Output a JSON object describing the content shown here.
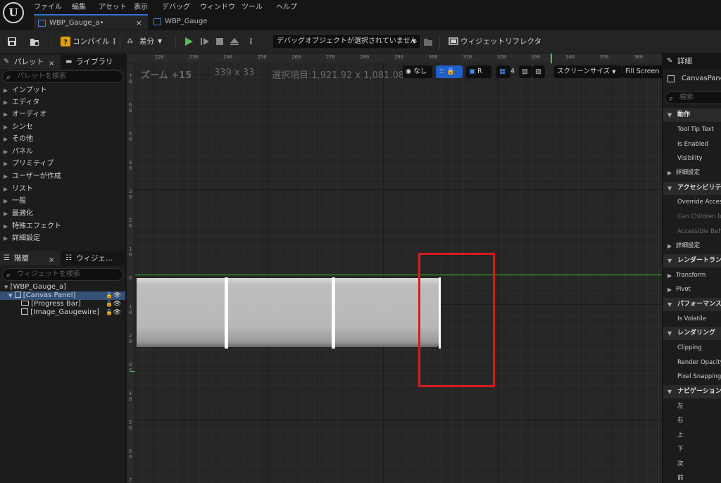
{
  "menu": {
    "logo": "U",
    "items": [
      "ファイル",
      "編集",
      "アセット",
      "表示",
      "デバッグ",
      "ウィンドウ",
      "ツール",
      "ヘルプ"
    ]
  },
  "tabs": [
    {
      "label": "WBP_Gauge_a•",
      "close": "×"
    },
    {
      "label": "WBP_Gauge"
    }
  ],
  "toolbar": {
    "compile_label": "コンパイル",
    "diff_label": "差分",
    "debug_object": "デバッグオブジェクトが選択されていません",
    "widget_reflector_label": "ウィジェットリフレクタ"
  },
  "palette": {
    "tab_palette": "パレット",
    "tab_library": "ライブラリ",
    "close": "×",
    "search_placeholder": "パレットを検索",
    "categories": [
      "インプット",
      "エディタ",
      "オーディオ",
      "シンセ",
      "その他",
      "パネル",
      "プリミティブ",
      "ユーザーが作成",
      "リスト",
      "一般",
      "最適化",
      "特殊エフェクト",
      "詳細設定"
    ]
  },
  "hierarchy": {
    "tab_hierarchy": "階層",
    "tab_widget": "ウィジェ...",
    "close": "×",
    "search_placeholder": "ウィジェットを検索",
    "root": "[WBP_Gauge_a]",
    "canvas_panel": "[Canvas Panel]",
    "progress_bar": "[Progress Bar]",
    "image_gaugewire": "[Image_Gaugewire]"
  },
  "canvas": {
    "zoom": "ズーム +15",
    "size": "339 x 33",
    "selection": "選択項目:1,921.92 x 1,081.08",
    "none_label": "なし",
    "r_label": "R",
    "grid_value": "4",
    "screen_size": "スクリーンサイズ",
    "fill_screen": "Fill Screen",
    "ruler_top": [
      "220",
      "230",
      "240",
      "250",
      "260",
      "270",
      "280",
      "290",
      "300",
      "310",
      "320",
      "330",
      "340",
      "350",
      "360",
      "370"
    ],
    "ruler_left": [
      "7\n0",
      "6\n0",
      "5\n0",
      "4\n0",
      "3\n0",
      "2\n0",
      "1\n0",
      "0",
      "1\n0",
      "2\n0",
      "3\n0",
      "4\n0",
      "5\n0",
      "6\n0",
      "7\n0"
    ]
  },
  "details": {
    "title": "詳細",
    "object_name": "CanvasPanel",
    "search_placeholder": "検索",
    "sections": {
      "behavior": "動作",
      "accessibility": "アクセシビリティ",
      "render_transform": "レンダートランスフォーム",
      "performance": "パフォーマンス",
      "rendering": "レンダリング",
      "navigation": "ナビゲーション"
    },
    "props": {
      "tooltip": "Tool Tip Text",
      "is_enabled": "Is Enabled",
      "visibility": "Visibility",
      "advanced1": "詳細設定",
      "override_access": "Override Accessible",
      "can_children": "Can Children be Accessible",
      "accessible_behavior": "Accessible Behavior",
      "advanced2": "詳細設定",
      "transform": "Transform",
      "pivot": "Pivot",
      "is_volatile": "Is Volatile",
      "clipping": "Clipping",
      "render_opacity": "Render Opacity",
      "pixel_snapping": "Pixel Snapping",
      "nav_left": "左",
      "nav_right": "右",
      "nav_up": "上",
      "nav_down": "下",
      "nav_next": "次",
      "nav_prev": "前"
    }
  },
  "colors": {
    "accent_blue": "#1f5fc8",
    "selection_red": "#d81b1b",
    "guide_green": "#31d331",
    "play_green": "#5cb85c"
  }
}
